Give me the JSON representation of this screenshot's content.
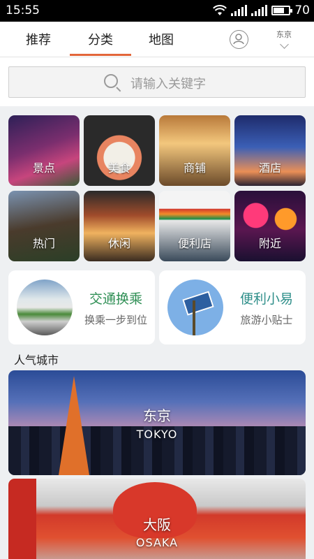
{
  "status_bar": {
    "time": "15:55",
    "battery_level": "70"
  },
  "nav": {
    "tabs": [
      {
        "label": "推荐",
        "active": false
      },
      {
        "label": "分类",
        "active": true
      },
      {
        "label": "地图",
        "active": false
      }
    ],
    "city": "东京",
    "accent_color": "#e2663a"
  },
  "search": {
    "placeholder": "请输入关键字"
  },
  "categories": [
    {
      "label": "景点"
    },
    {
      "label": "美食"
    },
    {
      "label": "商铺"
    },
    {
      "label": "酒店"
    },
    {
      "label": "热门"
    },
    {
      "label": "休闲"
    },
    {
      "label": "便利店"
    },
    {
      "label": "附近"
    }
  ],
  "features": [
    {
      "title": "交通换乘",
      "subtitle": "换乘一步到位",
      "color": "#2f8f55"
    },
    {
      "title": "便利小易",
      "subtitle": "旅游小贴士",
      "color": "#2f8f8a"
    }
  ],
  "popular": {
    "title": "人气城市",
    "cities": [
      {
        "name": "东京",
        "name_en": "TOKYO"
      },
      {
        "name": "大阪",
        "name_en": "OSAKA"
      }
    ]
  }
}
